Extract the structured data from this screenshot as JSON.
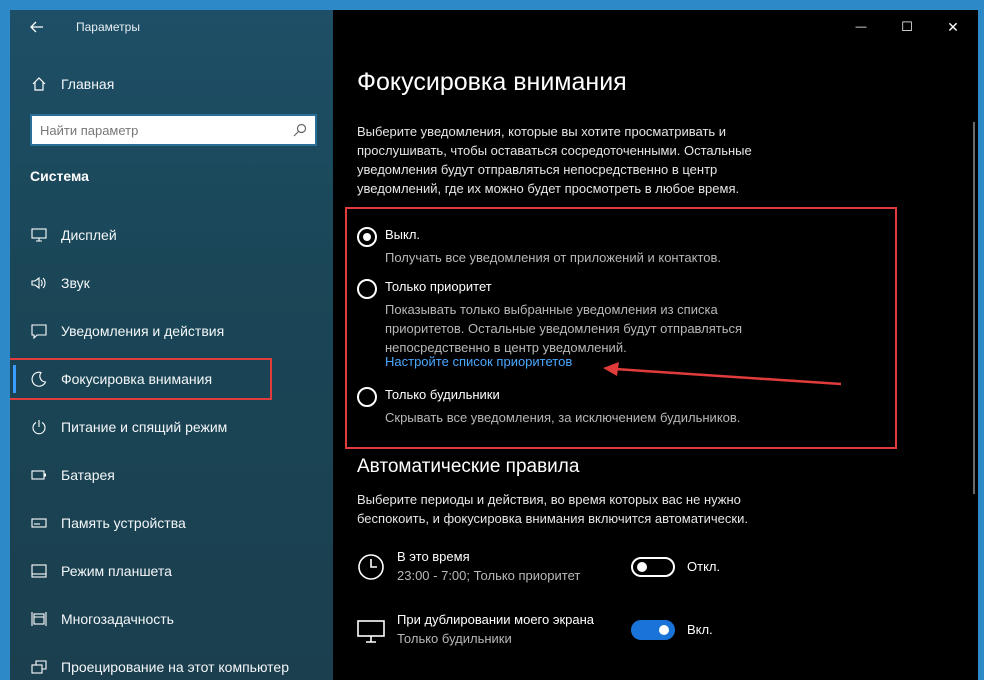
{
  "window": {
    "app_title": "Параметры",
    "minimize_symbol": "—",
    "maximize_symbol": "☐",
    "close_symbol": "✕"
  },
  "sidebar": {
    "home_label": "Главная",
    "search_placeholder": "Найти параметр",
    "section_title": "Система",
    "items": [
      {
        "label": "Дисплей",
        "icon": "display-icon"
      },
      {
        "label": "Звук",
        "icon": "speaker-icon"
      },
      {
        "label": "Уведомления и действия",
        "icon": "notification-icon"
      },
      {
        "label": "Фокусировка внимания",
        "icon": "moon-icon",
        "active": true
      },
      {
        "label": "Питание и спящий режим",
        "icon": "power-icon"
      },
      {
        "label": "Батарея",
        "icon": "battery-icon"
      },
      {
        "label": "Память устройства",
        "icon": "storage-icon"
      },
      {
        "label": "Режим планшета",
        "icon": "tablet-icon"
      },
      {
        "label": "Многозадачность",
        "icon": "multitasking-icon"
      },
      {
        "label": "Проецирование на этот компьютер",
        "icon": "projecting-icon"
      }
    ]
  },
  "main": {
    "title": "Фокусировка внимания",
    "description": [
      "Выберите уведомления, которые вы хотите просматривать и",
      "прослушивать, чтобы оставаться сосредоточенными. Остальные",
      "уведомления будут отправляться непосредственно в центр",
      "уведомлений, где их можно будет просмотреть в любое время."
    ],
    "options": [
      {
        "label": "Выкл.",
        "checked": true,
        "desc": [
          "Получать все уведомления от приложений и контактов."
        ]
      },
      {
        "label": "Только приоритет",
        "checked": false,
        "desc": [
          "Показывать только выбранные уведомления из списка",
          "приоритетов. Остальные уведомления будут отправляться",
          "непосредственно в центр уведомлений."
        ]
      },
      {
        "label": "Только будильники",
        "checked": false,
        "desc": [
          "Скрывать все уведомления, за исключением будильников."
        ]
      }
    ],
    "priority_link": "Настройте список приоритетов",
    "auto_rules": {
      "title": "Автоматические правила",
      "description": [
        "Выберите периоды и действия, во время которых вас не нужно",
        "беспокоить, и фокусировка внимания включится автоматически."
      ],
      "rules": [
        {
          "title": "В это время",
          "subtitle": "23:00 - 7:00; Только приоритет",
          "state": "off",
          "state_label": "Откл.",
          "icon": "clock-icon"
        },
        {
          "title": "При дублировании моего экрана",
          "subtitle": "Только будильники",
          "state": "on",
          "state_label": "Вкл.",
          "icon": "monitor-icon"
        }
      ]
    }
  },
  "colors": {
    "accent": "#1a73d9",
    "link": "#4aa8ff",
    "annotation_red": "#e23b3b",
    "desktop_blue": "#2e89c8"
  }
}
